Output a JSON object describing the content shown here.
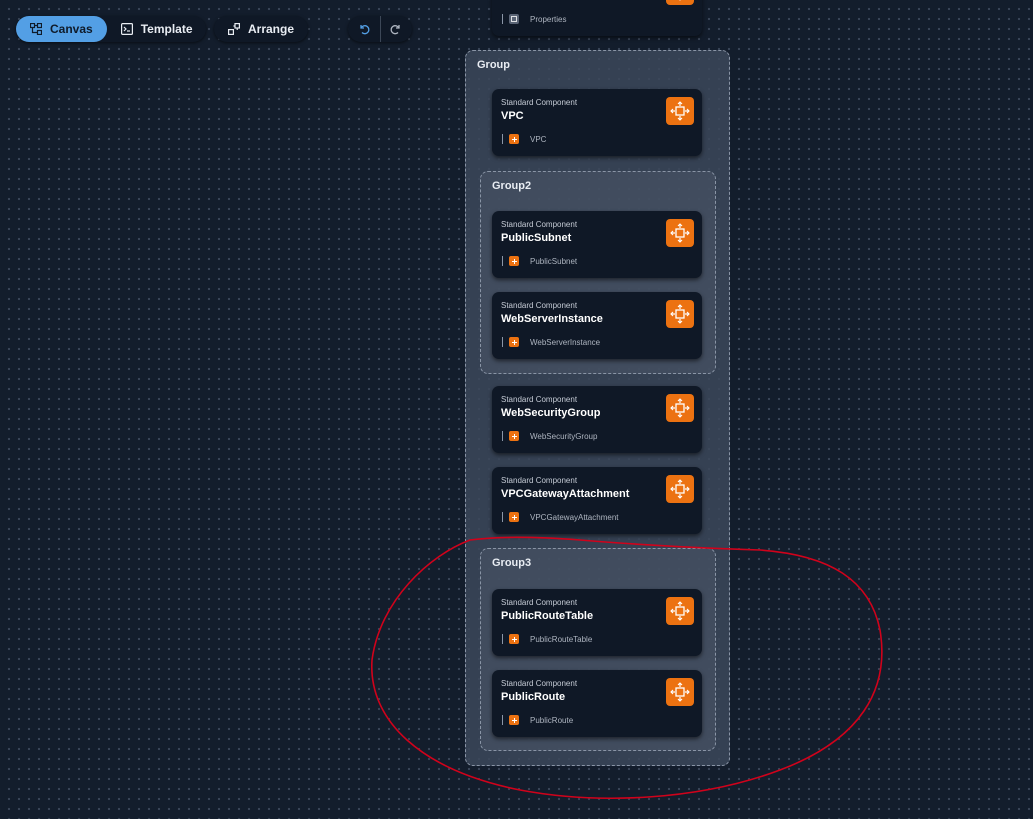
{
  "toolbar": {
    "canvas_label": "Canvas",
    "template_label": "Template",
    "arrange_label": "Arrange"
  },
  "top_card": {
    "footer": "Properties"
  },
  "groups": {
    "outer": "Group",
    "group2": "Group2",
    "group3": "Group3"
  },
  "cards": [
    {
      "type": "Standard Component",
      "name": "VPC",
      "footer": "VPC"
    },
    {
      "type": "Standard Component",
      "name": "PublicSubnet",
      "footer": "PublicSubnet"
    },
    {
      "type": "Standard Component",
      "name": "WebServerInstance",
      "footer": "WebServerInstance"
    },
    {
      "type": "Standard Component",
      "name": "WebSecurityGroup",
      "footer": "WebSecurityGroup"
    },
    {
      "type": "Standard Component",
      "name": "VPCGatewayAttachment",
      "footer": "VPCGatewayAttachment"
    },
    {
      "type": "Standard Component",
      "name": "PublicRouteTable",
      "footer": "PublicRouteTable"
    },
    {
      "type": "Standard Component",
      "name": "PublicRoute",
      "footer": "PublicRoute"
    }
  ],
  "icons": {
    "canvas": "canvas-icon",
    "template": "template-icon",
    "arrange": "arrange-icon",
    "undo": "undo-icon",
    "redo": "redo-icon",
    "aws_component": "aws-component-icon"
  },
  "colors": {
    "accent": "#539fe5",
    "aws_orange": "#ec7211",
    "background": "#131d2c",
    "annotation": "#d0021b"
  }
}
